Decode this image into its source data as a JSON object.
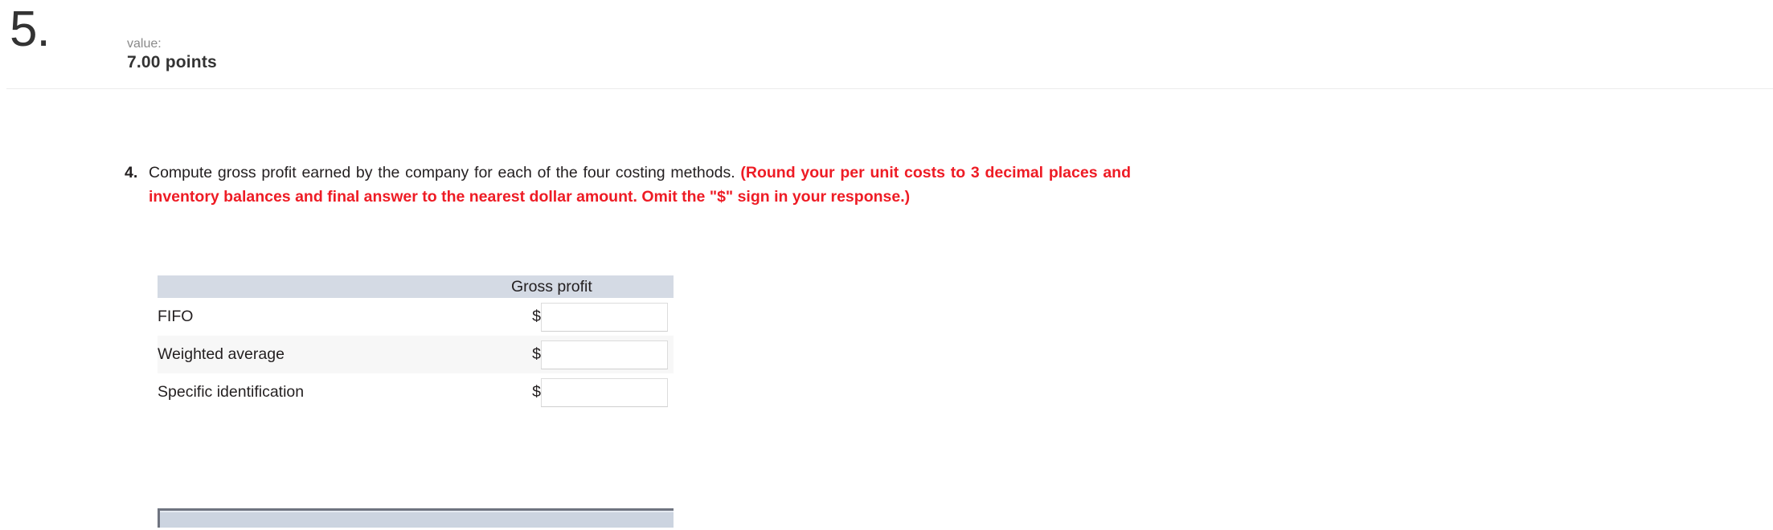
{
  "header": {
    "question_number": "5.",
    "value_label": "value:",
    "points": "7.00 points"
  },
  "question": {
    "marker": "4.",
    "text_plain": "Compute gross profit earned by the company for each of the four costing methods.",
    "text_instruction": "(Round your per unit costs to 3 decimal places and inventory balances and final answer to the nearest dollar amount. Omit the \"$\" sign in your response.)",
    "instruction_color": "#ee1c25"
  },
  "table": {
    "header_blank": "",
    "header_gross_profit": "Gross profit",
    "currency_symbol": "$",
    "rows": [
      {
        "label": "FIFO",
        "dollar": "$",
        "value": "",
        "placeholder": ""
      },
      {
        "label": "Weighted average",
        "dollar": "$",
        "value": "",
        "placeholder": ""
      },
      {
        "label": "Specific identification",
        "dollar": "$",
        "value": "",
        "placeholder": ""
      }
    ],
    "header_background": "#d4dae4",
    "alt_row_background": "#f7f7f7",
    "footer_bar_background": "#ccd4e0",
    "footer_bar_border": "#6f7480"
  }
}
